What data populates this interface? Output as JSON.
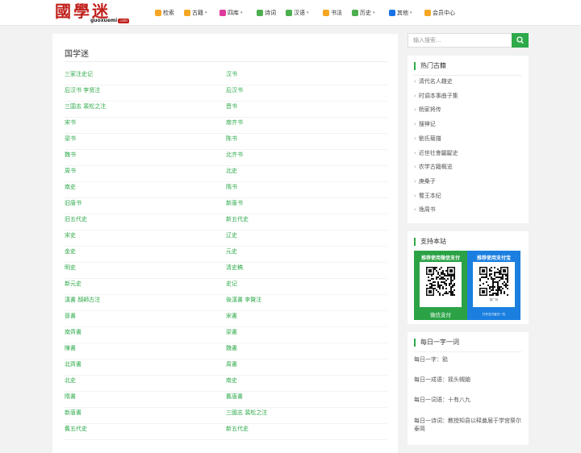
{
  "header": {
    "logo_glyphs": "國學迷",
    "logo_sub": "guoxuemi",
    "logo_badge": ".com",
    "nav": [
      {
        "label": "检索",
        "icon": "search-icon",
        "color": "#f5a623",
        "caret": false
      },
      {
        "label": "古籍",
        "icon": "book-icon",
        "color": "#f5a623",
        "caret": true
      },
      {
        "label": "四库",
        "icon": "camera-icon",
        "color": "#e0399c",
        "caret": true
      },
      {
        "label": "诗词",
        "icon": "document-icon",
        "color": "#4caf50",
        "caret": false
      },
      {
        "label": "汉语",
        "icon": "h-icon",
        "color": "#4caf50",
        "caret": true
      },
      {
        "label": "书法",
        "icon": "pencil-icon",
        "color": "#f5a623",
        "caret": false
      },
      {
        "label": "历史",
        "icon": "history-icon",
        "color": "#4caf50",
        "caret": true
      },
      {
        "label": "其他",
        "icon": "cart-icon",
        "color": "#1a73e8",
        "caret": true
      },
      {
        "label": "会员中心",
        "icon": "user-icon",
        "color": "#f5a623",
        "caret": false
      }
    ]
  },
  "main": {
    "title": "国学迷",
    "left_links": [
      "三家注史记",
      "后汉书 李贤注",
      "三国志 裴松之注",
      "宋书",
      "梁书",
      "魏书",
      "周书",
      "南史",
      "旧唐书",
      "旧五代史",
      "宋史",
      "金史",
      "明史",
      "新元史",
      "漢書 顏師古注",
      "晉書",
      "南齊書",
      "陳書",
      "北齊書",
      "北史",
      "隋書",
      "新唐書",
      "舊五代史"
    ],
    "right_links": [
      "汉书",
      "后汉书",
      "晋书",
      "南齐书",
      "陈书",
      "北齐书",
      "北史",
      "隋书",
      "新唐书",
      "新五代史",
      "辽史",
      "元史",
      "清史稿",
      "史记",
      "後漢書 李賢注",
      "宋書",
      "梁書",
      "魏書",
      "周書",
      "南史",
      "舊唐書",
      "三國志 裴松之注",
      "新五代史"
    ]
  },
  "search": {
    "placeholder": "输入搜索..."
  },
  "hot": {
    "title": "热门古籍",
    "items": [
      "清代名人趣史",
      "时调本事曲子集",
      "杨家将传",
      "搜神记",
      "劉氏菊譜",
      "近世社會齷齪史",
      "农学古籍概览",
      "庚桑子",
      "蜀王本纪",
      "逸周书"
    ]
  },
  "support": {
    "title": "支持本站",
    "wechat_head": "推荐使用微信支付",
    "wechat_foot": "微信支付",
    "alipay_head": "推荐使用支付宝",
    "alipay_caption": "推广码",
    "alipay_foot": "打开支付宝扫一扫"
  },
  "daily": {
    "title": "每日一字一词",
    "items": [
      "每日一字：𬌗",
      "每日一成语：摇头幌脑",
      "每日一词语：十有八九",
      "每日一诗词：教授知县以释奠届于学宫祭尔泰简"
    ]
  }
}
